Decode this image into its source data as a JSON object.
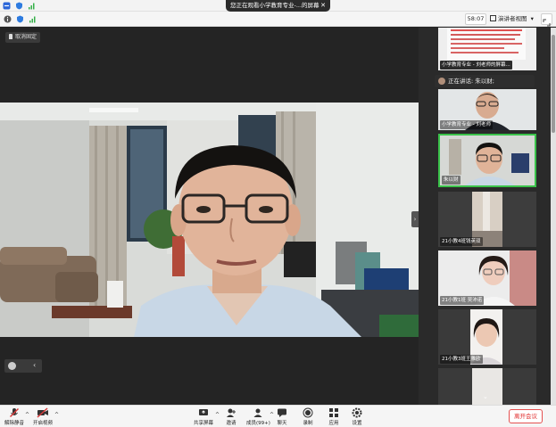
{
  "sysbar": {
    "share_notice": "您正在观看小学教育专业-...的屏幕",
    "close_label": "✕"
  },
  "toolbar": {
    "timer": "58:07",
    "view_label": "演讲者视图",
    "view_caret": "▾"
  },
  "main": {
    "stop_label": "取消固定",
    "collapse_arrow": "›"
  },
  "sidebar": {
    "speaking_label": "正在讲话: 朱以财;",
    "tiles": [
      {
        "name": "小学教育专业 - 刘老师的屏幕..."
      },
      {
        "name": "小学教育专业 - 刘老师"
      },
      {
        "name": "朱以财"
      },
      {
        "name": "21小教4班钱英双"
      },
      {
        "name": "21小教1班 吴沛诺"
      },
      {
        "name": "21小教3班王雅欧"
      },
      {
        "name": ""
      }
    ]
  },
  "bottombar": {
    "mic_label": "解除静音",
    "video_label": "开启视频",
    "share_label": "共享屏幕",
    "invite_label": "邀请",
    "members_label": "成员(99+)",
    "chat_label": "聊天",
    "record_label": "录制",
    "apps_label": "应用",
    "settings_label": "设置",
    "end_label": "离开会议"
  },
  "colors": {
    "end_red": "#e02b2b",
    "active_tile_border": "#3ac24a",
    "mic_red": "#d83b3b"
  }
}
